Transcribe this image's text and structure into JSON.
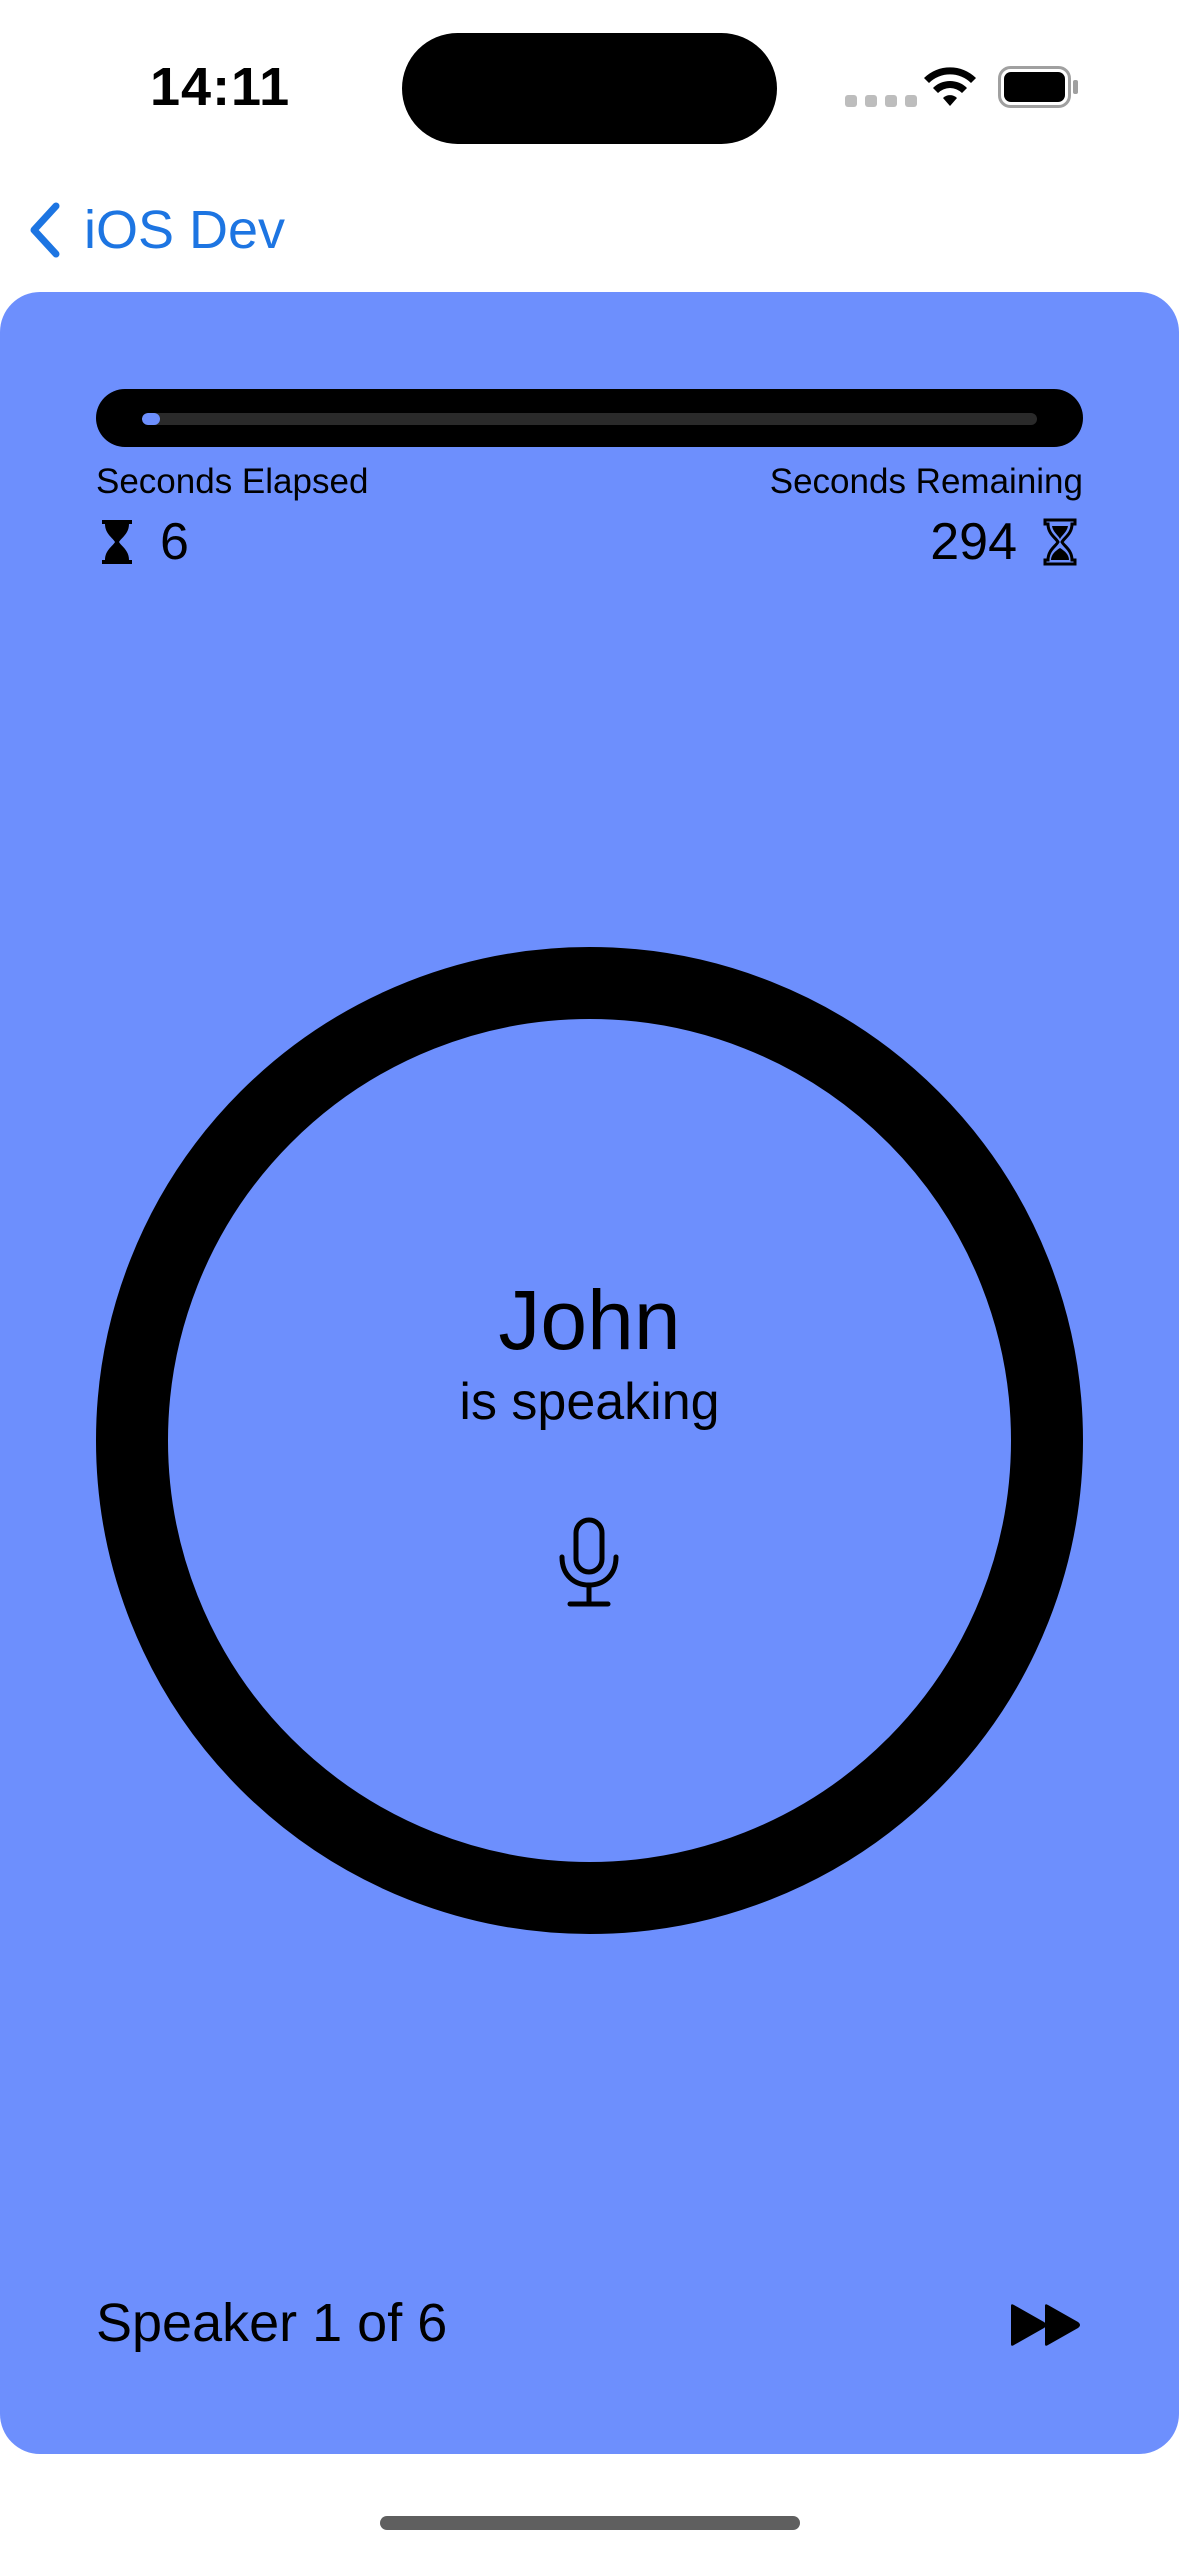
{
  "status_bar": {
    "time": "14:11",
    "wifi_icon": "wifi-icon",
    "battery_icon": "battery-full-icon"
  },
  "nav": {
    "back_label": "iOS Dev",
    "back_icon": "chevron-left-icon"
  },
  "colors": {
    "accent": "#1d75e2",
    "card_background": "#6d8ffd",
    "ring": "#000000"
  },
  "meeting": {
    "seconds_elapsed_label": "Seconds Elapsed",
    "seconds_remaining_label": "Seconds Remaining",
    "seconds_elapsed": "6",
    "seconds_remaining": "294",
    "progress_fraction": 0.02,
    "elapsed_icon": "hourglass-top-icon",
    "remaining_icon": "hourglass-bottom-icon"
  },
  "speaker": {
    "name": "John",
    "status": "is speaking",
    "icon": "mic-icon",
    "count_text": "Speaker 1 of 6",
    "skip_icon": "forward-icon"
  }
}
